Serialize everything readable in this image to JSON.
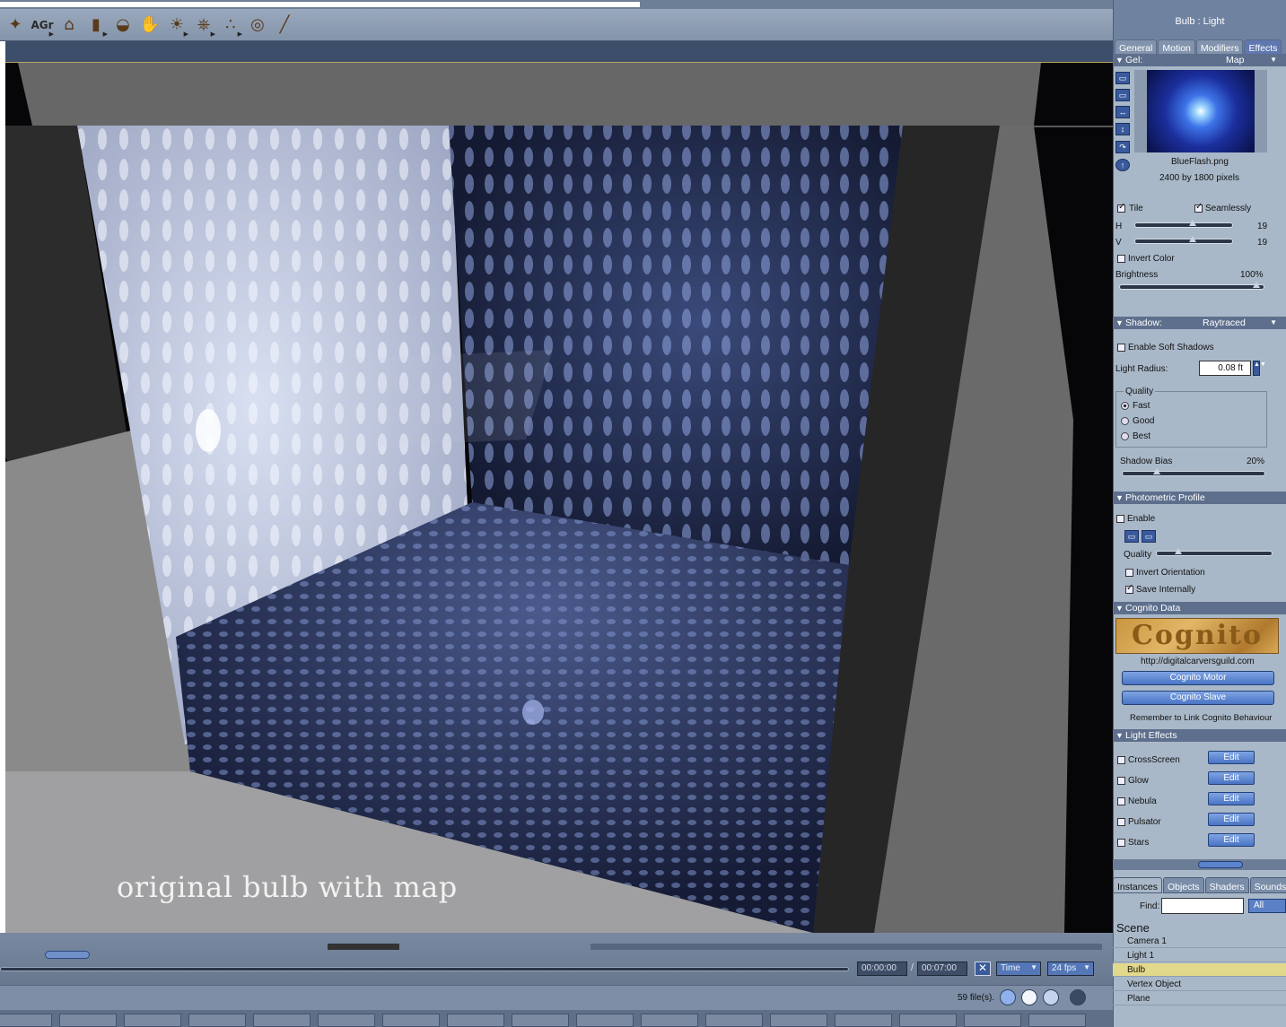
{
  "toolbar": {
    "items": [
      {
        "name": "figure-icon",
        "glyph": "✦",
        "menu": false
      },
      {
        "name": "agr-text",
        "text": "AGr",
        "menu": true
      },
      {
        "name": "house-icon",
        "glyph": "⌂",
        "menu": false
      },
      {
        "name": "cylinder-icon",
        "glyph": "▮",
        "menu": true
      },
      {
        "name": "bowl-icon",
        "glyph": "◒",
        "menu": false
      },
      {
        "name": "hand-icon",
        "glyph": "✋",
        "menu": false
      },
      {
        "name": "bulb-icon",
        "glyph": "☀",
        "menu": true
      },
      {
        "name": "camera-icon",
        "glyph": "⎈",
        "menu": true
      },
      {
        "name": "hierarchy-icon",
        "glyph": "∴",
        "menu": true
      },
      {
        "name": "target-icon",
        "glyph": "◎",
        "menu": false
      },
      {
        "name": "bone-icon",
        "glyph": "╱",
        "menu": false
      }
    ]
  },
  "viewport": {
    "caption": "original bulb with map"
  },
  "timeline": {
    "current_time": "00:00:00",
    "separator": "/",
    "end_time": "00:07:00",
    "time_mode": "Time",
    "fps": "24 fps"
  },
  "bottombar": {
    "files": "59 file(s)."
  },
  "panel": {
    "title": "Bulb : Light",
    "tabs": [
      "General",
      "Motion",
      "Modifiers",
      "Effects"
    ],
    "gel": {
      "label": "Gel:",
      "value": "Map",
      "filename": "BlueFlash.png",
      "dimensions": "2400 by 1800 pixels",
      "tile_label": "Tile",
      "seamlessly_label": "Seamlessly",
      "h_label": "H",
      "h_value": "19",
      "v_label": "V",
      "v_value": "19",
      "invert_color_label": "Invert Color",
      "brightness_label": "Brightness",
      "brightness_value": "100%"
    },
    "shadow": {
      "label": "Shadow:",
      "value": "Raytraced",
      "soft_shadows_label": "Enable Soft Shadows",
      "radius_label": "Light Radius:",
      "radius_value": "0.08 ft",
      "quality_label": "Quality",
      "quality_options": [
        "Fast",
        "Good",
        "Best"
      ],
      "bias_label": "Shadow Bias",
      "bias_value": "20%"
    },
    "photometric": {
      "label": "Photometric Profile",
      "enable_label": "Enable",
      "quality_label": "Quality",
      "invert_label": "Invert Orientation",
      "save_label": "Save Internally"
    },
    "cognito": {
      "label": "Cognito Data",
      "logo_text": "Cognito",
      "url": "http://digitalcarversguild.com",
      "motor_button": "Cognito Motor",
      "slave_button": "Cognito Slave",
      "note": "Remember to Link Cognito Behaviour"
    },
    "light_effects": {
      "label": "Light Effects",
      "edit_label": "Edit",
      "items": [
        "CrossScreen",
        "Glow",
        "Nebula",
        "Pulsator",
        "Stars"
      ]
    },
    "bottom_tabs": [
      "Instances",
      "Objects",
      "Shaders",
      "Sounds"
    ],
    "find_label": "Find:",
    "find_value": "",
    "all_button": "All",
    "scene_title": "Scene",
    "scene_items": [
      "Camera 1",
      "Light 1",
      "Bulb",
      "Vertex Object",
      "Plane"
    ],
    "selected_scene_item": "Bulb"
  },
  "colors": {
    "selection_highlight": "#e3d98c",
    "panel_background": "#a9b8c8",
    "accent_blue": "#4a74c4"
  }
}
